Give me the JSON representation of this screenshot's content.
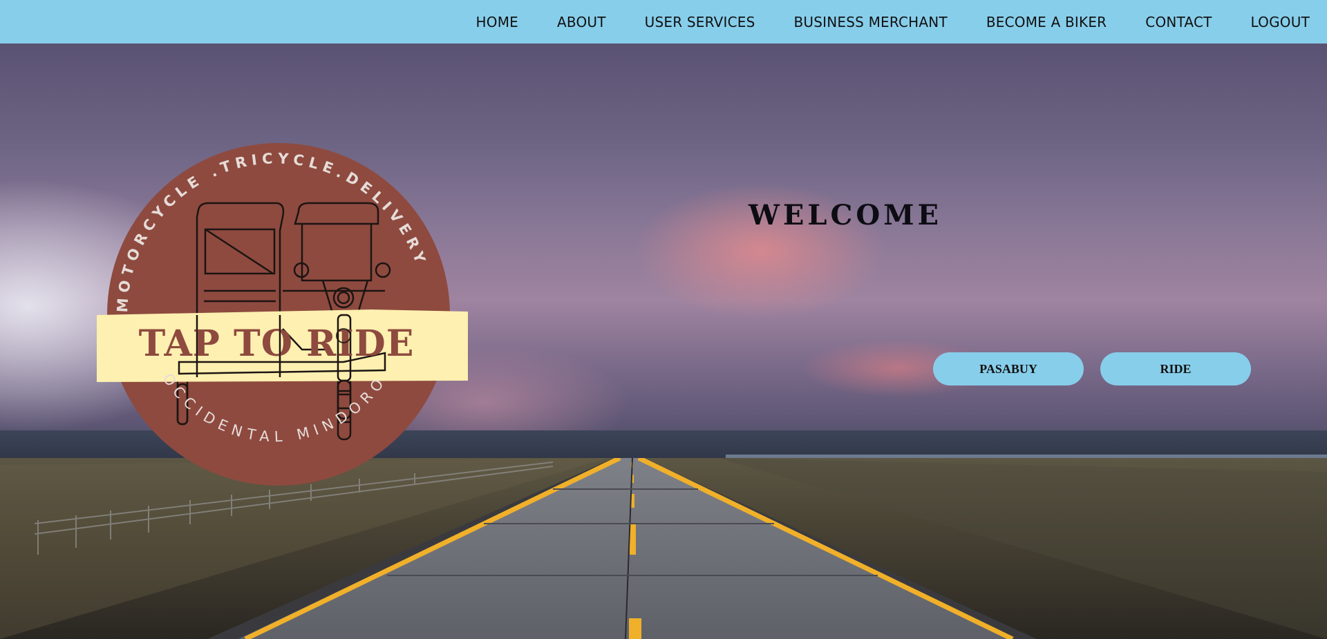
{
  "nav": {
    "items": [
      {
        "label": "HOME"
      },
      {
        "label": "ABOUT"
      },
      {
        "label": "USER SERVICES"
      },
      {
        "label": "BUSINESS MERCHANT"
      },
      {
        "label": "BECOME A BIKER"
      },
      {
        "label": "CONTACT"
      },
      {
        "label": "LOGOUT"
      }
    ]
  },
  "logo": {
    "arc_top_text": "MOTORCYCLE .TRICYCLE.DELIVERY",
    "banner_text": "TAP TO RIDE",
    "arc_bottom_text": "OCCIDENTAL MINDORO"
  },
  "hero": {
    "welcome": "WELCOME",
    "buttons": {
      "pasabuy": "PASABUY",
      "ride": "RIDE"
    }
  },
  "colors": {
    "nav_bg": "#87ceeb",
    "button_bg": "#87ceeb",
    "logo_circle": "#8e4a3f",
    "logo_banner": "#fdf0b0",
    "logo_text": "#8e4a3f"
  }
}
